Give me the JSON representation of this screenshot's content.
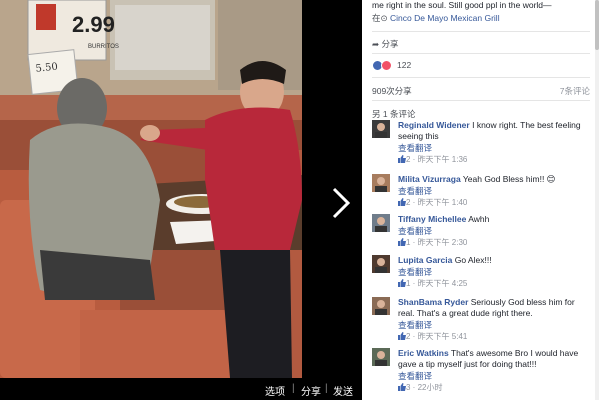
{
  "post": {
    "text": "me right in the soul. Still good ppl in the world—",
    "location_prefix": "在",
    "location": "Cinco De Mayo Mexican Grill",
    "share_label": "分享",
    "reaction_count": "122",
    "shares_text": "909次分享",
    "comments_count": "7条评论",
    "more_comments": "另 1 条评论"
  },
  "photo": {
    "sign_price": "2.99",
    "sign_label": "BURRITOS",
    "sign_small_price": "5.50"
  },
  "viewer_bar": {
    "options_label": "选项",
    "share_label": "分享",
    "send_label": "发送"
  },
  "comments": [
    {
      "name": "Reginald Widener",
      "text": "I know right. The best feeling seeing this",
      "translate": "查看翻译",
      "likes": "2",
      "time": "昨天下午 1:36"
    },
    {
      "name": "Milita Vizurraga",
      "text": "Yeah God Bless him!! 😊",
      "translate": "查看翻译",
      "likes": "2",
      "time": "昨天下午 1:40"
    },
    {
      "name": "Tiffany Michellee",
      "text": "Awhh",
      "translate": "查看翻译",
      "likes": "1",
      "time": "昨天下午 2:30"
    },
    {
      "name": "Lupita Garcia",
      "text": "Go Alex!!!",
      "translate": "查看翻译",
      "likes": "1",
      "time": "昨天下午 4:25"
    },
    {
      "name": "ShanBama Ryder",
      "text": "Seriously God bless him for real. That's a great dude right there.",
      "translate": "查看翻译",
      "likes": "2",
      "time": "昨天下午 5:41"
    },
    {
      "name": "Eric Watkins",
      "text": "That's awesome Bro I would have gave a tip myself just for doing that!!!",
      "translate": "查看翻译",
      "likes": "3",
      "time": "22小时"
    }
  ],
  "colors": {
    "link": "#365899",
    "like_blue": "#4267b2",
    "love_red": "#f25268",
    "meta_gray": "#90949c"
  }
}
